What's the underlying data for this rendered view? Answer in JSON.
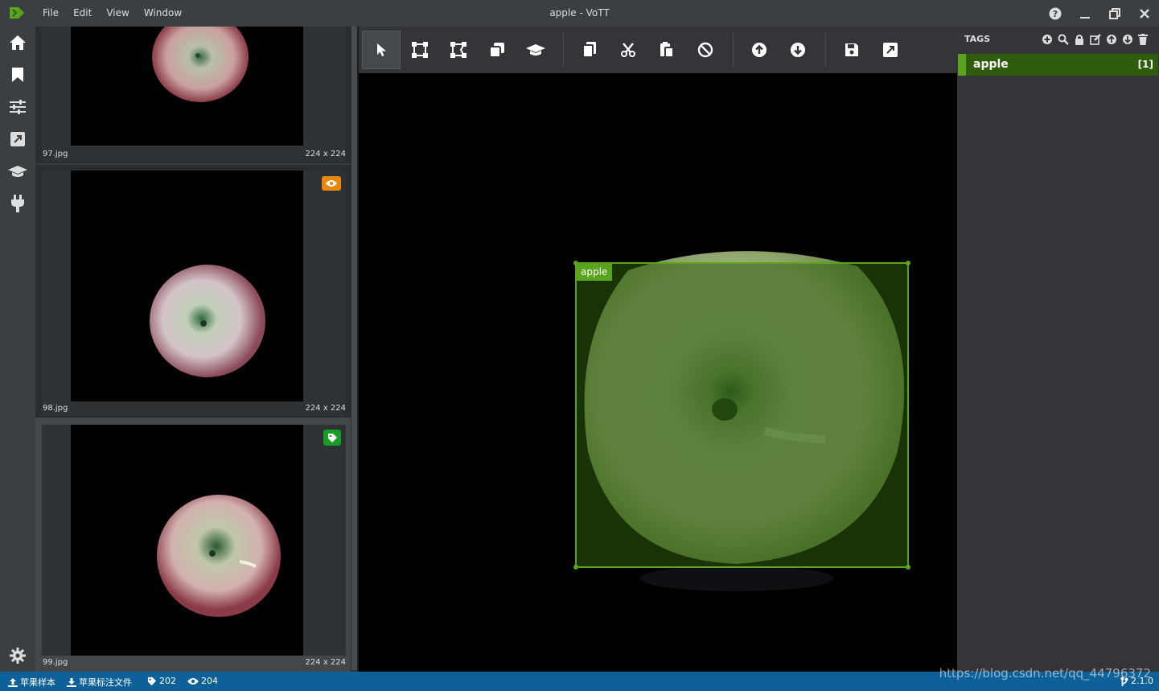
{
  "app": {
    "title": "apple - VoTT",
    "brand_color": "#5aa31d",
    "menu": [
      "File",
      "Edit",
      "View",
      "Window"
    ]
  },
  "rail": {
    "icons": [
      "home-icon",
      "bookmark-icon",
      "sliders-icon",
      "export-icon",
      "graduation-cap-icon",
      "plug-icon",
      "gear-icon"
    ]
  },
  "thumbnails": [
    {
      "name": "97.jpg",
      "size": "224 x 224",
      "badge": ""
    },
    {
      "name": "98.jpg",
      "size": "224 x 224",
      "badge": "eye-icon",
      "badge_color": "#e9880b"
    },
    {
      "name": "99.jpg",
      "size": "224 x 224",
      "badge": "tag-icon",
      "badge_color": "#179c26",
      "selected": true
    }
  ],
  "toolbar": {
    "icons": [
      "pointer-icon",
      "polygon-icon",
      "rectangle-icon",
      "copy-rect-icon",
      "active-learning-icon",
      "copy-icon",
      "cut-icon",
      "paste-icon",
      "clear-icon",
      "previous-icon",
      "next-icon",
      "save-icon",
      "export-icon"
    ]
  },
  "region": {
    "tag": "apple"
  },
  "tags": {
    "header": "TAGS",
    "items": [
      {
        "name": "apple",
        "hotkey": "[1]",
        "color": "#5aa31d"
      }
    ]
  },
  "status": {
    "source": "苹果样本",
    "target": "苹果标注文件",
    "tagged": "202",
    "visited": "204",
    "version": "2.1.0"
  },
  "watermark": "https://blog.csdn.net/qq_44796372"
}
